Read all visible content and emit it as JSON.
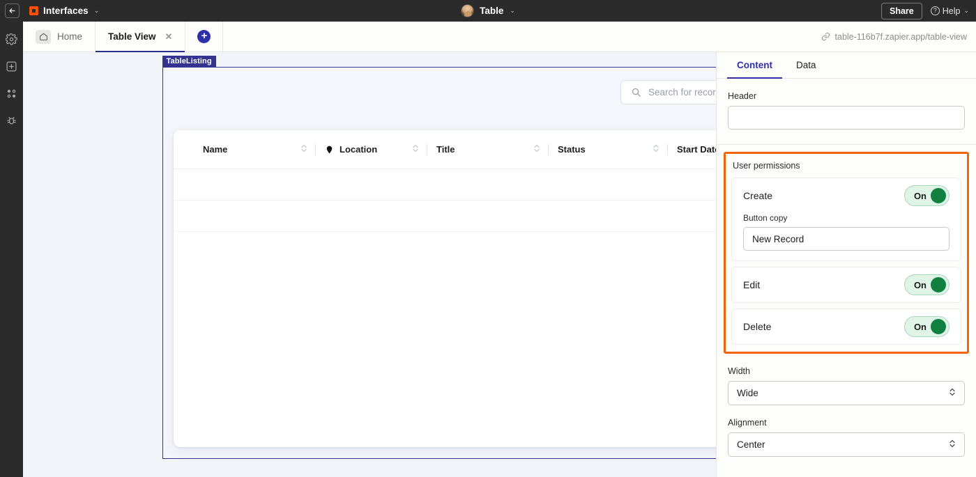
{
  "topbar": {
    "back_icon": "arrow-left-icon",
    "brand": "Interfaces",
    "brand_caret": "⌄",
    "center_title": "Table",
    "center_caret": "⌄",
    "share_label": "Share",
    "help_label": "Help",
    "help_caret": "⌄"
  },
  "rail": {
    "items": [
      {
        "icon": "gear-icon"
      },
      {
        "icon": "add-square-icon"
      },
      {
        "icon": "nodes-icon"
      },
      {
        "icon": "debug-bug-icon"
      }
    ]
  },
  "tabbar": {
    "home_label": "Home",
    "table_view_label": "Table View",
    "close_glyph": "✕",
    "add_glyph": "+",
    "url": "table-116b7f.zapier.app/table-view",
    "link_icon": "link-icon"
  },
  "canvas": {
    "selection_label": "TableListing",
    "search_placeholder": "Search for records",
    "search_icon": "search-icon",
    "columns": [
      {
        "label": "Name",
        "icon": null
      },
      {
        "label": "Location",
        "icon": "map-pin-icon"
      },
      {
        "label": "Title",
        "icon": null
      },
      {
        "label": "Status",
        "icon": null
      },
      {
        "label": "Start Date",
        "icon": null
      }
    ],
    "sort_glyph": "⌃⌄"
  },
  "panel": {
    "tabs": [
      {
        "label": "Content",
        "active": true
      },
      {
        "label": "Data",
        "active": false
      }
    ],
    "header_label": "Header",
    "header_value": "",
    "header_placeholder": "",
    "permissions": {
      "title": "User permissions",
      "rows": [
        {
          "name": "Create",
          "toggle_label": "On",
          "sub_label": "Button copy",
          "sub_value": "New Record"
        },
        {
          "name": "Edit",
          "toggle_label": "On"
        },
        {
          "name": "Delete",
          "toggle_label": "On"
        }
      ]
    },
    "width_label": "Width",
    "width_value": "Wide",
    "alignment_label": "Alignment",
    "alignment_value": "Center",
    "stepper_glyph": "⌃⌄"
  },
  "colors": {
    "brand_orange": "#ff4f00",
    "highlight_orange": "#f2640a",
    "indigo": "#2f2fa8",
    "selection_indigo": "#343490",
    "toggle_green": "#12813f",
    "toggle_track": "#dff3e6",
    "topbar_dark": "#2b2b2b"
  }
}
